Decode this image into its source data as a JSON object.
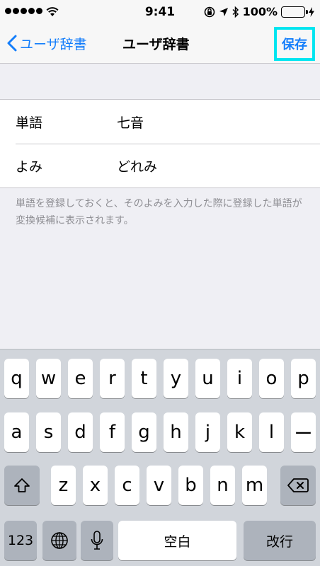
{
  "status_bar": {
    "time": "9:41",
    "battery_percent_label": "100%",
    "battery_level": 1.0,
    "battery_color": "#4cd964",
    "icons": [
      "orientation-lock-icon",
      "location-arrow-icon",
      "bluetooth-icon",
      "charging-bolt-icon"
    ]
  },
  "nav": {
    "back_label": "ユーザ辞書",
    "title": "ユーザ辞書",
    "save_label": "保存",
    "accent_color": "#147efb"
  },
  "form": {
    "rows": [
      {
        "label": "単語",
        "value": "七音"
      },
      {
        "label": "よみ",
        "value": "どれみ"
      }
    ],
    "help_text": "単語を登録しておくと、そのよみを入力した際に登録した単語が変換候補に表示されます。"
  },
  "keyboard": {
    "row1": [
      "q",
      "w",
      "e",
      "r",
      "t",
      "y",
      "u",
      "i",
      "o",
      "p"
    ],
    "row2": [
      "a",
      "s",
      "d",
      "f",
      "g",
      "h",
      "j",
      "k",
      "l",
      "ー"
    ],
    "row3": [
      "z",
      "x",
      "c",
      "v",
      "b",
      "n",
      "m"
    ],
    "numbers_label": "123",
    "space_label": "空白",
    "return_label": "改行"
  }
}
